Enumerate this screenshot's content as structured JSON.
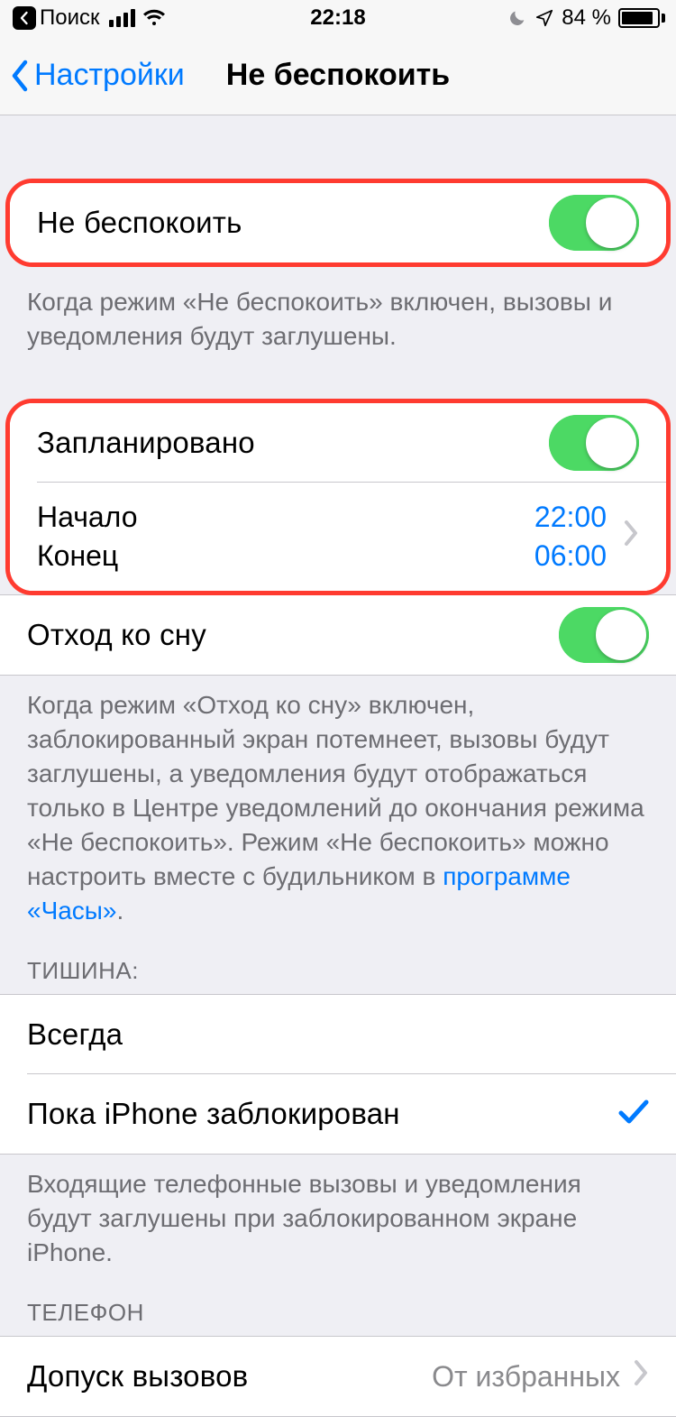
{
  "status": {
    "back_app": "Поиск",
    "time": "22:18",
    "battery_pct": "84 %"
  },
  "nav": {
    "back": "Настройки",
    "title": "Не беспокоить"
  },
  "dnd": {
    "label": "Не беспокоить",
    "footer": "Когда режим «Не беспокоить» включен, вызовы и уведомления будут заглушены."
  },
  "schedule": {
    "scheduled_label": "Запланировано",
    "from_label": "Начало",
    "to_label": "Конец",
    "from_value": "22:00",
    "to_value": "06:00"
  },
  "bedtime": {
    "label": "Отход ко сну",
    "footer_pre": "Когда режим «Отход ко сну» включен, заблокированный экран потемнеет, вызовы будут заглушены, а уведомления будут отображаться только в Центре уведомлений до окончания режима «Не беспокоить». Режим «Не беспокоить» можно настроить вместе с будильником в ",
    "footer_link": "программе «Часы»",
    "footer_post": "."
  },
  "silence": {
    "header": "ТИШИНА:",
    "always": "Всегда",
    "locked": "Пока iPhone заблокирован",
    "footer": "Входящие телефонные вызовы и уведомления будут заглушены при заблокированном экране iPhone."
  },
  "phone": {
    "header": "ТЕЛЕФОН",
    "allow_label": "Допуск вызовов",
    "allow_value": "От избранных"
  }
}
